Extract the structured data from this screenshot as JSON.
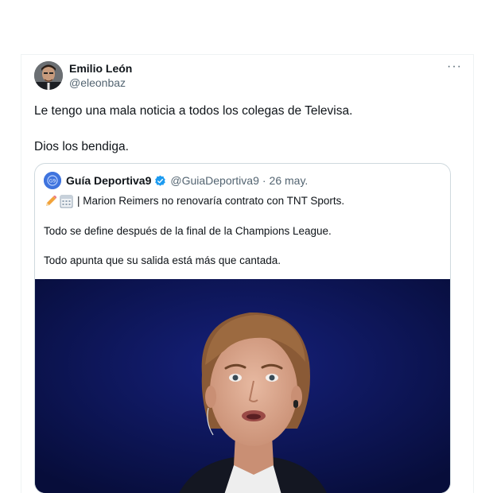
{
  "tweet": {
    "author_name": "Emilio León",
    "author_handle": "@eleonbaz",
    "more_label": "···",
    "text_line1": "Le tengo una mala noticia a todos los colegas de Televisa.",
    "text_line2": "Dios los bendiga."
  },
  "quote": {
    "author_name": "Guía Deportiva9",
    "author_handle": "@GuiaDeportiva9",
    "separator": "·",
    "date": "26 may.",
    "line1": "| Marion Reimers no renovaría contrato con TNT Sports.",
    "line2": "Todo se define después de la final de la Champions League.",
    "line3": "Todo apunta que su salida está más que cantada.",
    "media_icon": "photo-of-woman-presenter"
  },
  "colors": {
    "verified": "#1d9bf0",
    "media_background": "#0b1448",
    "secondary_text": "#536471"
  }
}
